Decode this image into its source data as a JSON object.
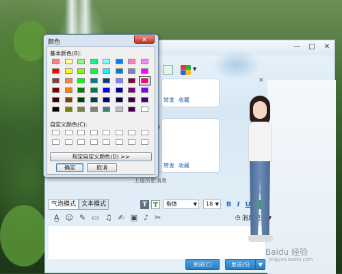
{
  "color_dialog": {
    "title": "颜色",
    "close_icon": "close-x-icon",
    "basic_colors_label": "基本颜色(B):",
    "basic_colors": [
      [
        "#ff8080",
        "#ffff80",
        "#80ff80",
        "#00ff80",
        "#80ffff",
        "#0080ff",
        "#ff80c0",
        "#ff80ff"
      ],
      [
        "#ff0000",
        "#ffff00",
        "#80ff00",
        "#00ff40",
        "#00ffff",
        "#0080c0",
        "#8080c0",
        "#ff00ff"
      ],
      [
        "#804040",
        "#ff8040",
        "#00ff00",
        "#008080",
        "#004080",
        "#8080ff",
        "#800040",
        "#ff0080"
      ],
      [
        "#800000",
        "#ff8000",
        "#008000",
        "#008040",
        "#0000ff",
        "#0000a0",
        "#800080",
        "#8000ff"
      ],
      [
        "#400000",
        "#804000",
        "#004000",
        "#004040",
        "#000080",
        "#000040",
        "#400040",
        "#400080"
      ],
      [
        "#000000",
        "#808000",
        "#808040",
        "#808080",
        "#408080",
        "#c0c0c0",
        "#400040",
        "#ffffff"
      ]
    ],
    "selected_color": "#ff0080",
    "custom_colors_label": "自定义颜色(C):",
    "custom_colors_rows": 2,
    "custom_colors_cols": 8,
    "define_custom_label": "规定自定义颜色(D) >>",
    "ok_label": "确定",
    "cancel_label": "取消"
  },
  "chat_window": {
    "titlebar_buttons": [
      "—",
      "□",
      "✕"
    ],
    "message_panels": [
      {
        "partial_text": "",
        "links": [
          "转发",
          "收藏"
        ]
      },
      {
        "partial_text": "e)",
        "links": [
          "转发",
          "收藏"
        ]
      }
    ],
    "history_checkbox_text": "上遥历史消息",
    "mode_tabs": [
      {
        "label": "气泡模式",
        "active": true
      },
      {
        "label": "文本模式",
        "active": false
      }
    ],
    "font_name": "楷体",
    "font_size": "18",
    "format_buttons": [
      "B",
      "I",
      "U"
    ],
    "history_label": "消息记录",
    "close_button": "关闭(C)",
    "send_button": "发送(S)"
  },
  "watermark": {
    "main": "Baidu 经验",
    "sub": "jingyan.baidu.com"
  }
}
